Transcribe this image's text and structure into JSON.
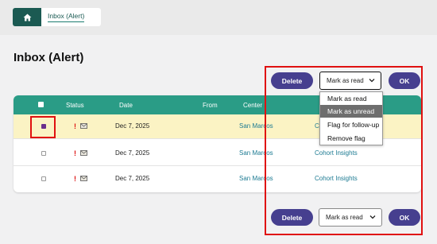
{
  "breadcrumb": {
    "home_icon": "home-icon",
    "current": "Inbox (Alert)"
  },
  "page": {
    "title": "Inbox (Alert)"
  },
  "actions_top": {
    "delete_label": "Delete",
    "select_value": "Mark as read",
    "ok_label": "OK"
  },
  "actions_bottom": {
    "delete_label": "Delete",
    "select_value": "Mark as read",
    "ok_label": "OK"
  },
  "dropdown": {
    "options": [
      "Mark as read",
      "Mark as unread",
      "Flag for follow-up",
      "Remove flag"
    ],
    "highlighted": "Mark as unread"
  },
  "table": {
    "headers": {
      "status": "Status",
      "date": "Date",
      "from": "From",
      "center": "Center"
    },
    "rows": [
      {
        "selected": true,
        "date": "Dec 7, 2025",
        "from": "",
        "center": "San Marcos",
        "program": "Co"
      },
      {
        "selected": false,
        "date": "Dec 7, 2025",
        "from": "",
        "center": "San Marcos",
        "program": "Cohort Insights"
      },
      {
        "selected": false,
        "date": "Dec 7, 2025",
        "from": "",
        "center": "San Marcos",
        "program": "Cohort Insights"
      }
    ]
  },
  "colors": {
    "header_teal": "#2a9c86",
    "button_purple": "#463f8f",
    "selected_row": "#fbf3c4",
    "annotation_red": "#e01010",
    "link_teal": "#1c7a92"
  }
}
